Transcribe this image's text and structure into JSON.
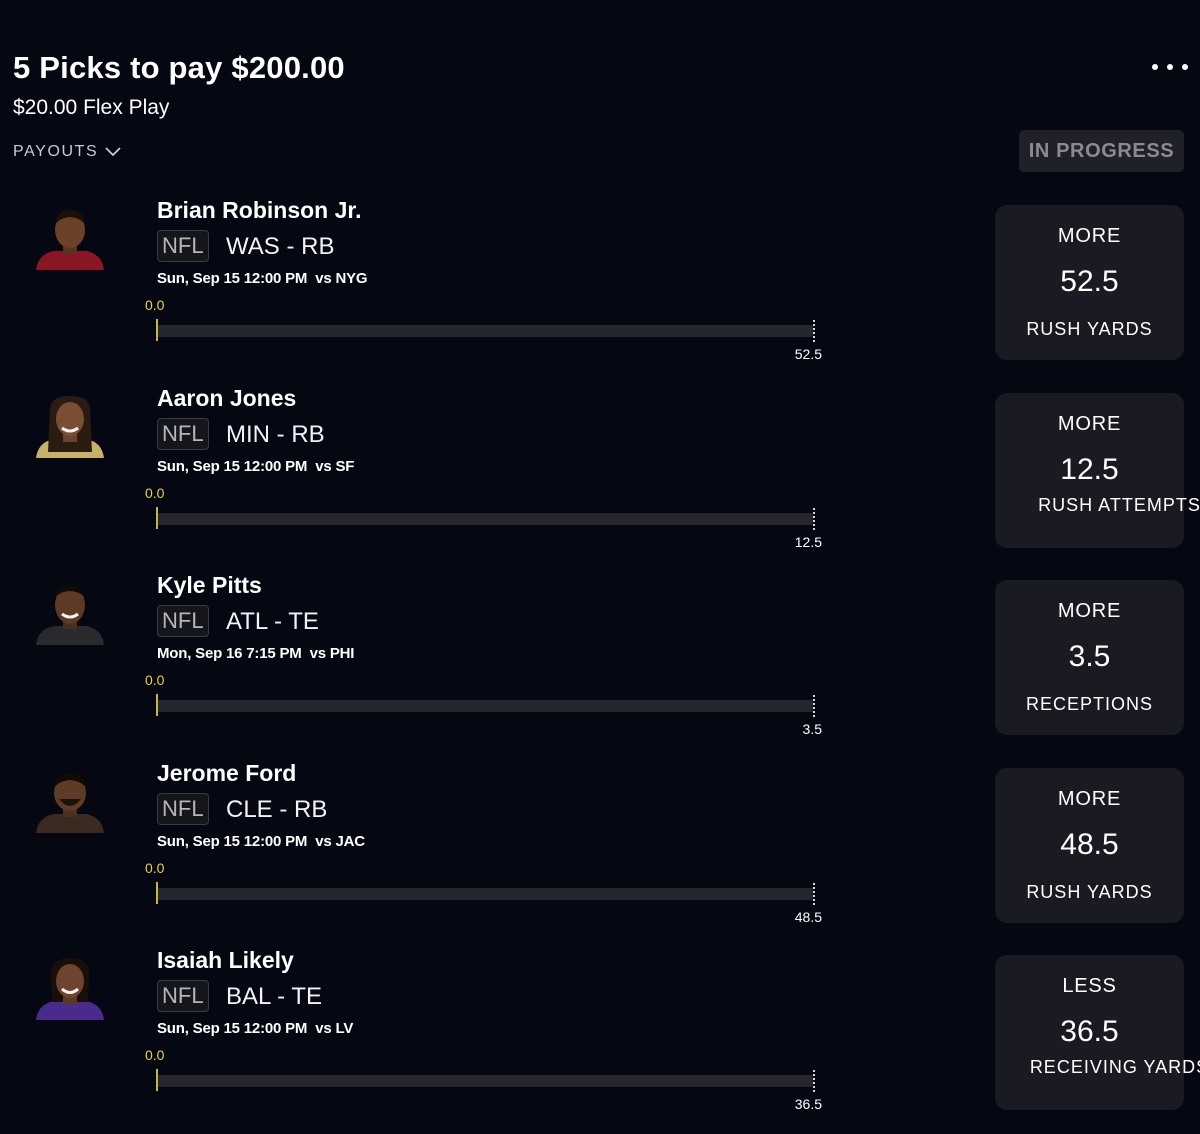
{
  "header": {
    "title": "5 Picks to pay $200.00",
    "subtitle": "$20.00 Flex Play",
    "payouts_label": "PAYOUTS",
    "status": "IN PROGRESS"
  },
  "colors": {
    "background": "#050712",
    "card": "#1a1b22",
    "progress_current": "#e7d04a",
    "status_text": "#8a8b91"
  },
  "picks": [
    {
      "player": "Brian Robinson Jr.",
      "league": "NFL",
      "team_pos": "WAS - RB",
      "game_time": "Sun, Sep 15 12:00 PM",
      "opponent": "vs NYG",
      "current": "0.0",
      "progress": 0,
      "target": "52.5",
      "direction": "MORE",
      "line": "52.5",
      "stat": "RUSH YARDS",
      "jersey_color": "#8a1524"
    },
    {
      "player": "Aaron Jones",
      "league": "NFL",
      "team_pos": "MIN - RB",
      "game_time": "Sun, Sep 15 12:00 PM",
      "opponent": "vs SF",
      "current": "0.0",
      "progress": 0,
      "target": "12.5",
      "direction": "MORE",
      "line": "12.5",
      "stat": "RUSH ATTEMPTS",
      "jersey_color": "#c9b16a"
    },
    {
      "player": "Kyle Pitts",
      "league": "NFL",
      "team_pos": "ATL - TE",
      "game_time": "Mon, Sep 16 7:15 PM",
      "opponent": "vs PHI",
      "current": "0.0",
      "progress": 0,
      "target": "3.5",
      "direction": "MORE",
      "line": "3.5",
      "stat": "RECEPTIONS",
      "jersey_color": "#2a2a2e"
    },
    {
      "player": "Jerome Ford",
      "league": "NFL",
      "team_pos": "CLE - RB",
      "game_time": "Sun, Sep 15 12:00 PM",
      "opponent": "vs JAC",
      "current": "0.0",
      "progress": 0,
      "target": "48.5",
      "direction": "MORE",
      "line": "48.5",
      "stat": "RUSH YARDS",
      "jersey_color": "#3a2a22"
    },
    {
      "player": "Isaiah Likely",
      "league": "NFL",
      "team_pos": "BAL - TE",
      "game_time": "Sun, Sep 15 12:00 PM",
      "opponent": "vs LV",
      "current": "0.0",
      "progress": 0,
      "target": "36.5",
      "direction": "LESS",
      "line": "36.5",
      "stat": "RECEIVING YARDS",
      "jersey_color": "#4a2a8a"
    }
  ]
}
